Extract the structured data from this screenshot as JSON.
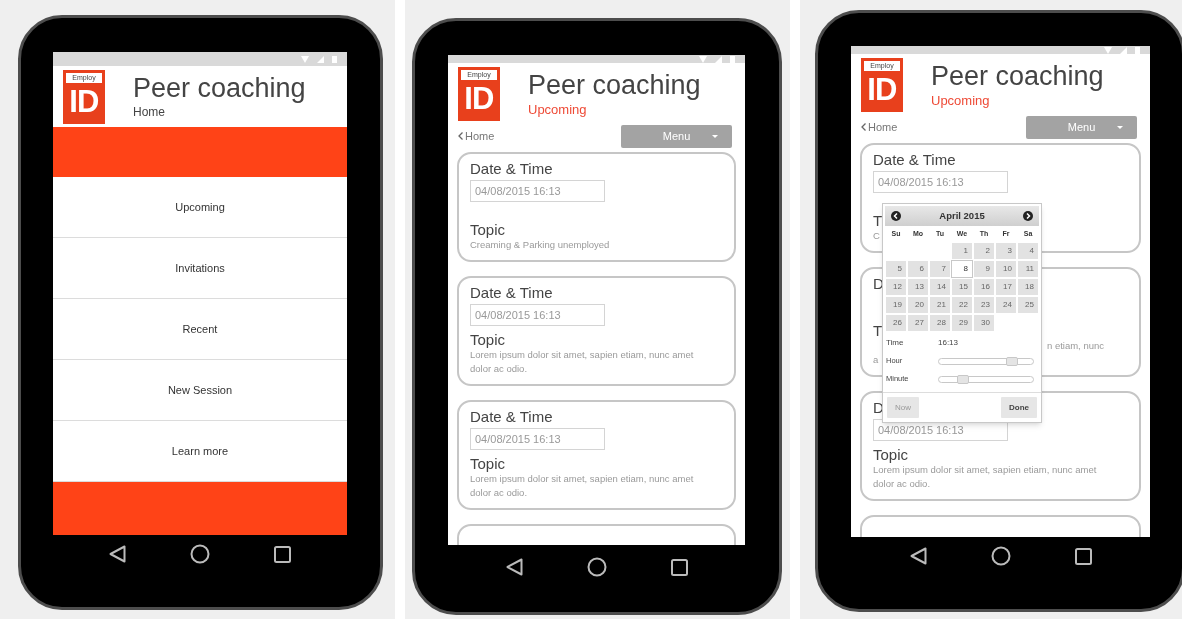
{
  "screens": [
    {
      "kind": "home",
      "logo": {
        "top": "Employ",
        "mark": "ID"
      },
      "title": "Peer coaching",
      "subtitle": "Home",
      "menu_items": [
        "Upcoming",
        "Invitations",
        "Recent",
        "New Session",
        "Learn more"
      ]
    },
    {
      "kind": "sessions",
      "logo": {
        "top": "Employ",
        "mark": "ID"
      },
      "title": "Peer coaching",
      "subtitle": "Upcoming",
      "back_link": "Home",
      "menu_button": "Menu",
      "cards": [
        {
          "kind": "session",
          "title": "Date & Time",
          "date": "04/08/2015 16:13",
          "topic_label": "Topic",
          "topic": "Creaming & Parking unemployed"
        },
        {
          "kind": "session",
          "title": "Date & Time",
          "date": "04/08/2015 16:13",
          "topic_label": "Topic",
          "topic": "Lorem ipsum dolor sit amet, sapien etiam, nunc amet dolor ac odio."
        },
        {
          "kind": "session",
          "title": "Date & Time",
          "date": "04/08/2015 16:13",
          "topic_label": "Topic",
          "topic": "Lorem ipsum dolor sit amet, sapien etiam, nunc amet dolor ac odio."
        },
        {
          "kind": "empty"
        }
      ]
    },
    {
      "kind": "sessions",
      "logo": {
        "top": "Employ",
        "mark": "ID"
      },
      "title": "Peer coaching",
      "subtitle": "Upcoming",
      "back_link": "Home",
      "menu_button": "Menu",
      "cards": [
        {
          "kind": "session",
          "title": "Date & Time",
          "date": "04/08/2015 16:13",
          "topic_label": "T",
          "topic": "C"
        },
        {
          "kind": "session",
          "title": "D",
          "topic_label": "T",
          "topic_parts": [
            {
              "text": "n etiam, nunc",
              "kind": "line_end"
            },
            {
              "text": "a",
              "kind": "line_start"
            }
          ]
        },
        {
          "kind": "session",
          "title": "D",
          "date": "04/08/2015 16:13",
          "topic_label": "Topic",
          "topic": "Lorem ipsum dolor sit amet, sapien etiam, nunc amet dolor ac odio."
        },
        {
          "kind": "empty"
        }
      ],
      "date_picker": {
        "month": "April 2015",
        "weekdays": [
          "Su",
          "Mo",
          "Tu",
          "We",
          "Th",
          "Fr",
          "Sa"
        ],
        "weeks": [
          {
            "days": [
              {
                "label": "1",
                "selected": false
              },
              {
                "label": "2",
                "selected": false
              },
              {
                "label": "3",
                "selected": false
              },
              {
                "label": "4",
                "selected": false
              }
            ]
          },
          {
            "days": [
              {
                "label": "5",
                "selected": false
              },
              {
                "label": "6",
                "selected": false
              },
              {
                "label": "7",
                "selected": false
              },
              {
                "label": "8",
                "selected": true
              },
              {
                "label": "9",
                "selected": false
              },
              {
                "label": "10",
                "selected": false
              },
              {
                "label": "11",
                "selected": false
              }
            ]
          },
          {
            "days": [
              {
                "label": "12",
                "selected": false
              },
              {
                "label": "13",
                "selected": false
              },
              {
                "label": "14",
                "selected": false
              },
              {
                "label": "15",
                "selected": false
              },
              {
                "label": "16",
                "selected": false
              },
              {
                "label": "17",
                "selected": false
              },
              {
                "label": "18",
                "selected": false
              }
            ]
          },
          {
            "days": [
              {
                "label": "19",
                "selected": false
              },
              {
                "label": "20",
                "selected": false
              },
              {
                "label": "21",
                "selected": false
              },
              {
                "label": "22",
                "selected": false
              },
              {
                "label": "23",
                "selected": false
              },
              {
                "label": "24",
                "selected": false
              },
              {
                "label": "25",
                "selected": false
              }
            ]
          },
          {
            "days": [
              {
                "label": "26",
                "selected": false
              },
              {
                "label": "27",
                "selected": false
              },
              {
                "label": "28",
                "selected": false
              },
              {
                "label": "29",
                "selected": false
              },
              {
                "label": "30",
                "selected": false
              }
            ]
          }
        ],
        "time_label": "Time",
        "time_value": "16:13",
        "sliders": [
          {
            "label": "Hour",
            "level": 0.78
          },
          {
            "label": "Minute",
            "level": 0.25
          }
        ],
        "buttons": [
          {
            "label": "Now",
            "disabled": true
          },
          {
            "label": "Done",
            "disabled": false
          }
        ]
      }
    }
  ]
}
